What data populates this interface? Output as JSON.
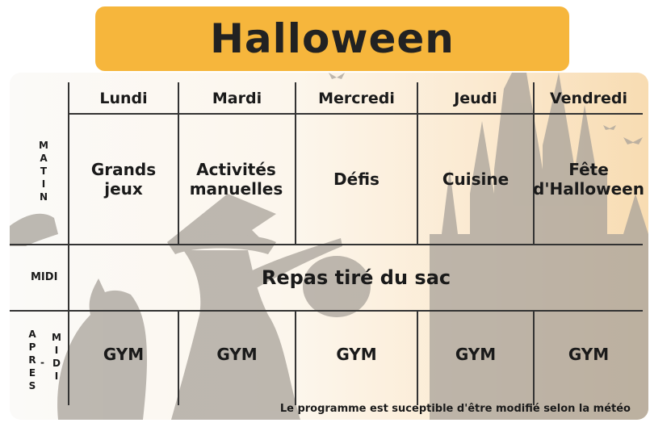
{
  "title": "Halloween",
  "days": [
    "Lundi",
    "Mardi",
    "Mercredi",
    "Jeudi",
    "Vendredi"
  ],
  "rows": {
    "matin_label": [
      "M",
      "A",
      "T",
      "I",
      "N"
    ],
    "midi_label": "MIDI",
    "apres_label": [
      "A",
      "P",
      "R",
      "E",
      "S"
    ],
    "apres_dash": "-",
    "apres_midi_label": [
      "M",
      "I",
      "D",
      "I"
    ]
  },
  "matin": [
    "Grands jeux",
    "Activités manuelles",
    "Défis",
    "Cuisine",
    "Fête d'Halloween"
  ],
  "midi": "Repas tiré du sac",
  "apres_midi": [
    "GYM",
    "GYM",
    "GYM",
    "GYM",
    "GYM"
  ],
  "note": "Le programme est suceptible d'être modifié selon la météo",
  "colors": {
    "title_bg": "#f6b63c",
    "silhouette": "#a8a29a",
    "text": "#1a1a1a"
  }
}
